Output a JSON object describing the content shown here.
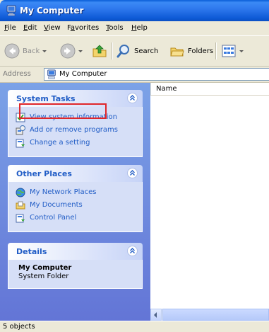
{
  "window": {
    "title": "My Computer"
  },
  "menu": [
    {
      "accel": "F",
      "rest": "ile"
    },
    {
      "accel": "E",
      "rest": "dit"
    },
    {
      "accel": "V",
      "rest": "iew"
    },
    {
      "pre": "F",
      "accel": "a",
      "rest": "vorites"
    },
    {
      "accel": "T",
      "rest": "ools"
    },
    {
      "accel": "H",
      "rest": "elp"
    }
  ],
  "toolbar": {
    "back_label": "Back",
    "search_label": "Search",
    "folders_label": "Folders"
  },
  "address": {
    "label": "Address",
    "value": "My Computer"
  },
  "system_tasks": {
    "title": "System Tasks",
    "items": [
      "View system information",
      "Add or remove programs",
      "Change a setting"
    ]
  },
  "other_places": {
    "title": "Other Places",
    "items": [
      "My Network Places",
      "My Documents",
      "Control Panel"
    ]
  },
  "details": {
    "title": "Details",
    "name": "My Computer",
    "type": "System Folder"
  },
  "content": {
    "column_name": "Name"
  },
  "status": {
    "text": "5 objects"
  },
  "colors": {
    "titlebar": "#0a5fd8",
    "taskpane_link": "#215dc6",
    "highlight": "#e0262a"
  }
}
